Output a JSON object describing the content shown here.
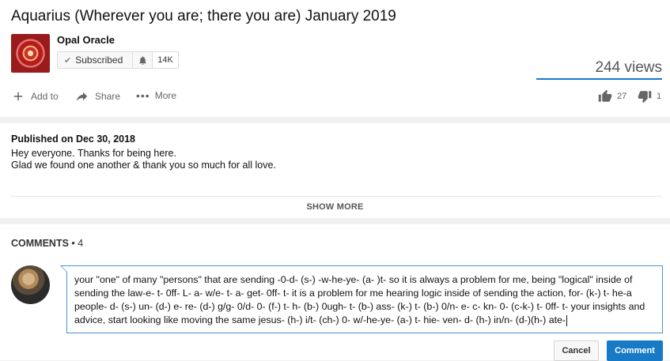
{
  "video": {
    "title": "Aquarius (Wherever you are; there you are) January 2019",
    "views": "244 views"
  },
  "channel": {
    "name": "Opal Oracle",
    "subscribe_label": "Subscribed",
    "subscriber_count": "14K"
  },
  "actions": {
    "add_to": "Add to",
    "share": "Share",
    "more": "More",
    "likes": "27",
    "dislikes": "1"
  },
  "description": {
    "published": "Published on Dec 30, 2018",
    "line1": "Hey everyone. Thanks for being here.",
    "line2": "Glad we found one another & thank you so much for all love.",
    "show_more": "SHOW MORE"
  },
  "comments": {
    "header": "COMMENTS",
    "count": "• 4",
    "draft": "your \"one\" of many \"persons\" that are sending -0-d- (s-) -w-he-ye- (a- )t-  so it is always a problem for me, being \"logical\" inside of sending the law-e- t- 0ff- L- a- w/e- t- a- get- 0ff- t-   it is a problem for me hearing logic inside of sending the action, for- (k-) t- he-a people- d- (s-) un- (d-) e- re- (d-) g/g- 0/d- 0- (f-) t- h- (b-) 0ugh- t- (b-) ass- (k-) t- (b-) 0/n- e- c- kn- 0- (c-k-) t- 0ff- t-   your insights and advice, start looking like moving the same jesus- (h-) i/t- (ch-) 0- w/-he-ye- (a-) t- hie- ven- d- (h-) in/n- (d-)(h-) ate-",
    "cancel_label": "Cancel",
    "comment_label": "Comment"
  },
  "colors": {
    "accent": "#167ac6",
    "sentiment_bar": "#1976d2"
  }
}
